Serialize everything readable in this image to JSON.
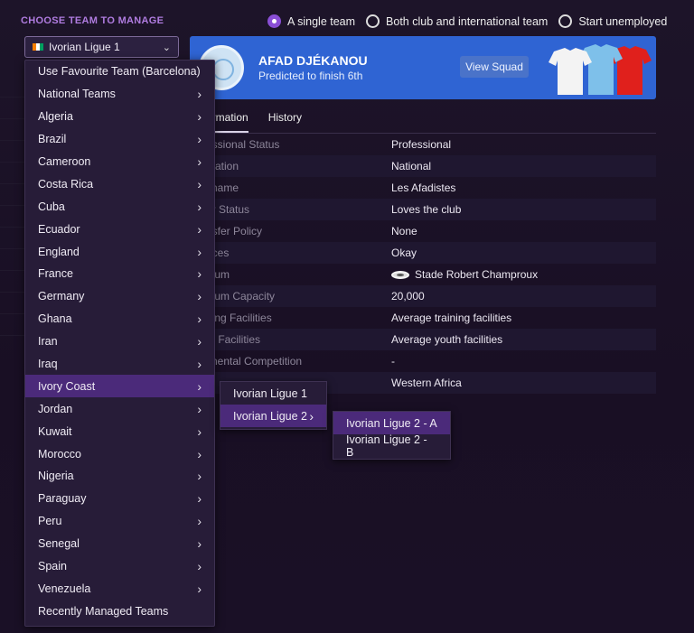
{
  "header": {
    "choose_title": "CHOOSE TEAM TO MANAGE",
    "selected_league": "Ivorian Ligue 1",
    "selected_flag_colors": [
      "#f77f00",
      "#ffffff",
      "#009e60"
    ]
  },
  "manage_options": [
    {
      "label": "A single team",
      "checked": true
    },
    {
      "label": "Both club and international team",
      "checked": false
    },
    {
      "label": "Start unemployed",
      "checked": false
    }
  ],
  "club": {
    "name": "AFAD DJÉKANOU",
    "prediction": "Predicted to finish 6th",
    "view_squad_label": "View Squad",
    "banner_color": "#2f64d3"
  },
  "tabs": [
    {
      "label": "ormation",
      "active": true
    },
    {
      "label": "History",
      "active": false
    }
  ],
  "info": [
    {
      "key": "essional Status",
      "value": "Professional"
    },
    {
      "key": "utation",
      "value": "National"
    },
    {
      "key": "kname",
      "value": "Les Afadistes"
    },
    {
      "key": "er Status",
      "value": "Loves the club"
    },
    {
      "key": "nsfer Policy",
      "value": "None"
    },
    {
      "key": "nces",
      "value": "Okay"
    },
    {
      "key": "dium",
      "value": "Stade Robert Champroux",
      "icon": "stadium-icon"
    },
    {
      "key": "dium Capacity",
      "value": "20,000"
    },
    {
      "key": "ning Facilities",
      "value": "Average training facilities"
    },
    {
      "key": "th Facilities",
      "value": "Average youth facilities"
    },
    {
      "key": "tinental Competition",
      "value": "-"
    },
    {
      "key": "",
      "value": "Western Africa"
    }
  ],
  "menu": [
    {
      "label": "Use Favourite Team (Barcelona)",
      "arrow": false
    },
    {
      "label": "National Teams",
      "arrow": true
    },
    {
      "label": "Algeria",
      "arrow": true
    },
    {
      "label": "Brazil",
      "arrow": true
    },
    {
      "label": "Cameroon",
      "arrow": true
    },
    {
      "label": "Costa Rica",
      "arrow": true
    },
    {
      "label": "Cuba",
      "arrow": true
    },
    {
      "label": "Ecuador",
      "arrow": true
    },
    {
      "label": "England",
      "arrow": true
    },
    {
      "label": "France",
      "arrow": true
    },
    {
      "label": "Germany",
      "arrow": true
    },
    {
      "label": "Ghana",
      "arrow": true
    },
    {
      "label": "Iran",
      "arrow": true
    },
    {
      "label": "Iraq",
      "arrow": true
    },
    {
      "label": "Ivory Coast",
      "arrow": true,
      "active": true
    },
    {
      "label": "Jordan",
      "arrow": true
    },
    {
      "label": "Kuwait",
      "arrow": true
    },
    {
      "label": "Morocco",
      "arrow": true
    },
    {
      "label": "Nigeria",
      "arrow": true
    },
    {
      "label": "Paraguay",
      "arrow": true
    },
    {
      "label": "Peru",
      "arrow": true
    },
    {
      "label": "Senegal",
      "arrow": true
    },
    {
      "label": "Spain",
      "arrow": true
    },
    {
      "label": "Venezuela",
      "arrow": true
    },
    {
      "label": "Recently Managed Teams",
      "arrow": false
    }
  ],
  "submenu_leagues": [
    {
      "label": "Ivorian Ligue 1",
      "arrow": false
    },
    {
      "label": "Ivorian Ligue 2",
      "arrow": true,
      "active": true
    }
  ],
  "submenu_divisions": [
    {
      "label": "Ivorian Ligue 2 - A",
      "active": true
    },
    {
      "label": "Ivorian Ligue 2 - B",
      "active": false
    }
  ],
  "icons": {
    "chevron": "chevron-down-icon",
    "arrow": "chevron-right-icon"
  },
  "colors": {
    "accent": "#8a4fd6",
    "title": "#b07ce0",
    "active_row": "#4b2a7a"
  }
}
